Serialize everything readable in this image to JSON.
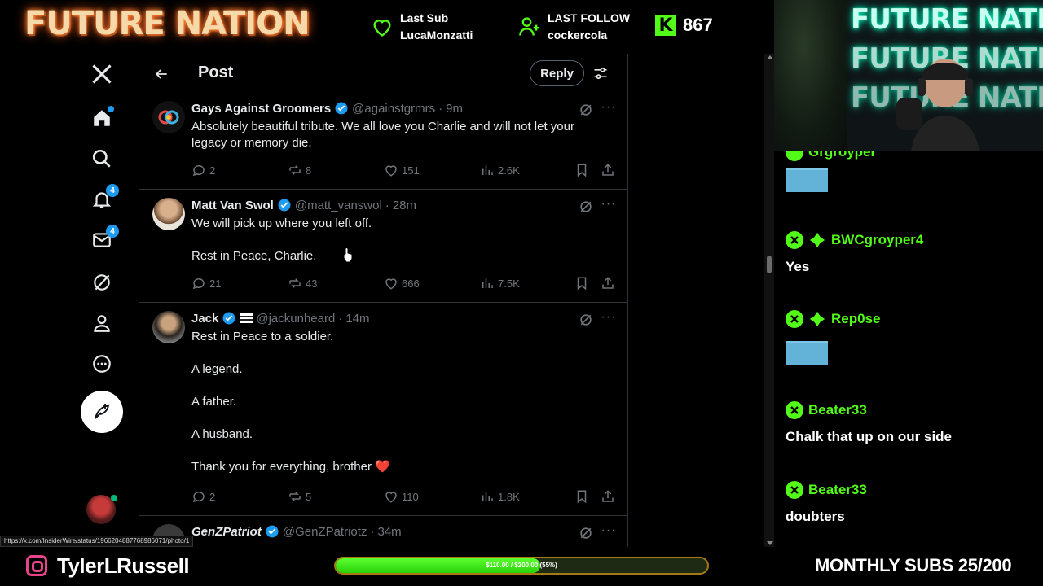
{
  "overlay": {
    "brand": "FUTURE NATION",
    "last_sub_label": "Last Sub",
    "last_sub_name": "LucaMonzatti",
    "last_follow_label": "LAST FOLLOW",
    "last_follow_name": "cockercola",
    "kick_logo": "K",
    "kick_count": "867",
    "accent_color": "#53fc18"
  },
  "x": {
    "header_title": "Post",
    "reply_button": "Reply",
    "nav": {
      "notifications_badge": "4",
      "messages_badge": "4"
    },
    "tweets": [
      {
        "name": "Gays Against Groomers",
        "handle": "@againstgrmrs",
        "time": "9m",
        "lines": [
          "Absolutely beautiful tribute. We all love you Charlie and will not let your legacy or memory die."
        ],
        "replies": "2",
        "reposts": "8",
        "likes": "151",
        "views": "2.6K"
      },
      {
        "name": "Matt Van Swol",
        "handle": "@matt_vanswol",
        "time": "28m",
        "lines": [
          "We will pick up where you left off.",
          "",
          "Rest in Peace, Charlie."
        ],
        "replies": "21",
        "reposts": "43",
        "likes": "666",
        "views": "7.5K"
      },
      {
        "name": "Jack",
        "handle": "@jackunheard",
        "time": "14m",
        "lines": [
          "Rest in Peace to a soldier.",
          "",
          "A legend.",
          "",
          "A father.",
          "",
          "A husband.",
          "",
          "Thank you for everything, brother ❤️"
        ],
        "replies": "2",
        "reposts": "5",
        "likes": "110",
        "views": "1.8K"
      },
      {
        "name": "GenZPatriot",
        "handle": "@GenZPatriotz",
        "time": "34m"
      }
    ],
    "status_url": "https://x.com/InsiderWire/status/1966204887768986071/photo/1"
  },
  "webcam": {
    "neon_lines": [
      "FUTURE NATION",
      "FUTURE NATION",
      "FUTURE NATION"
    ]
  },
  "chat": {
    "partial_user": "Grgroyper",
    "messages": [
      {
        "user": "BWCgroyper4",
        "text": "Yes"
      },
      {
        "user": "Rep0se",
        "text": ""
      },
      {
        "user": "Beater33",
        "text": "Chalk that up on our side"
      },
      {
        "user": "Beater33",
        "text": "doubters"
      }
    ]
  },
  "footer": {
    "instagram_handle": "TylerLRussell",
    "goal_text": "$110.00 / $200.00 (55%)",
    "goal_progress": 0.55,
    "monthly_subs": "MONTHLY SUBS 25/200"
  }
}
